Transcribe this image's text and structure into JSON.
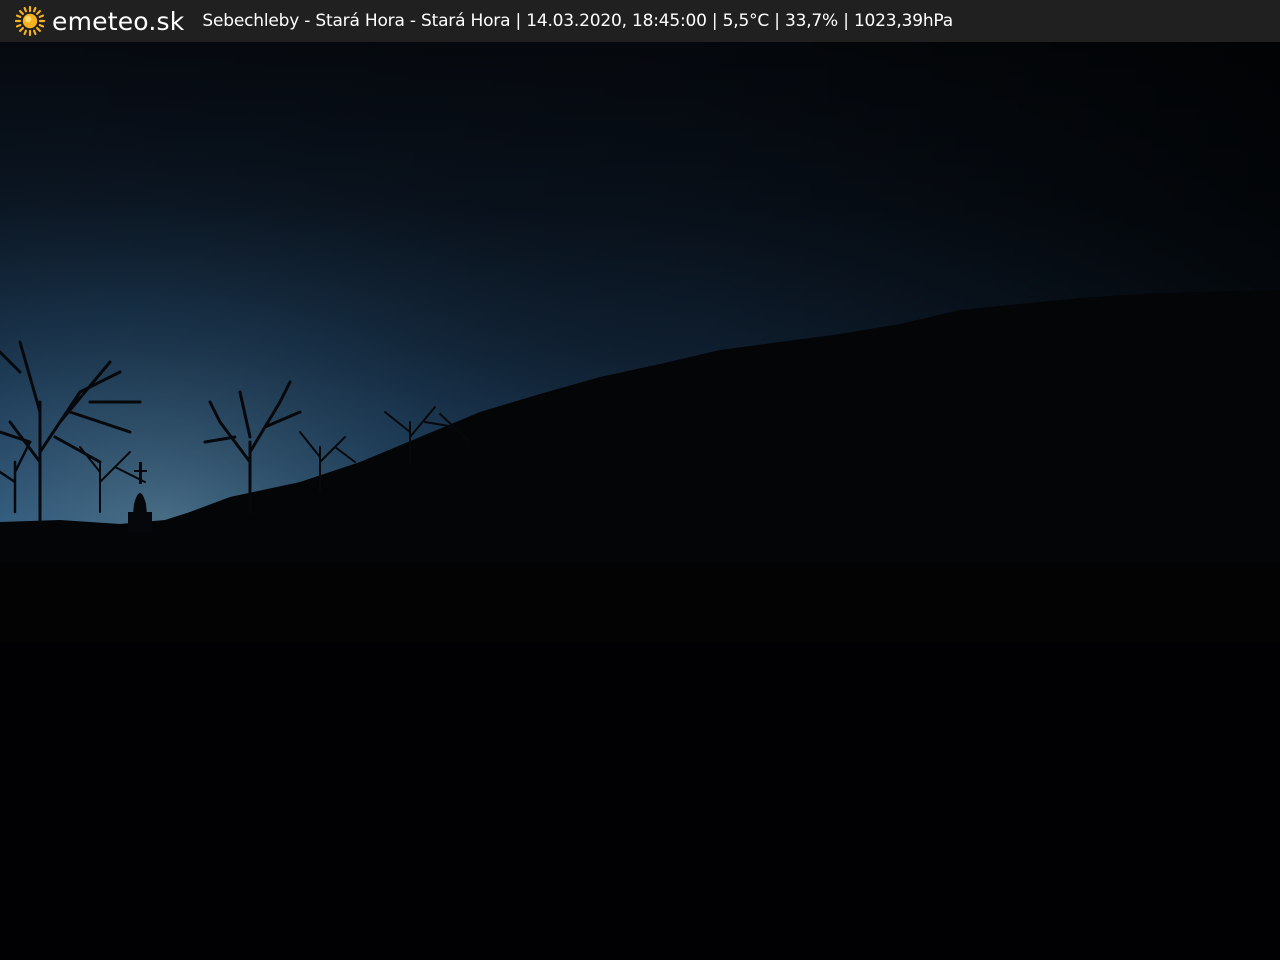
{
  "header": {
    "brand": "emeteo.sk",
    "logo_icon": "sun-icon",
    "caption": "Sebechleby - Stará Hora - Stará Hora | 14.03.2020, 18:45:00 | 5,5°C | 33,7% | 1023,39hPa"
  },
  "colors": {
    "bar_background": "#202020",
    "sun": "#f5b21e",
    "sky_top": "#05080d",
    "sky_horizon": "#2b5a86",
    "ground": "#030405"
  }
}
